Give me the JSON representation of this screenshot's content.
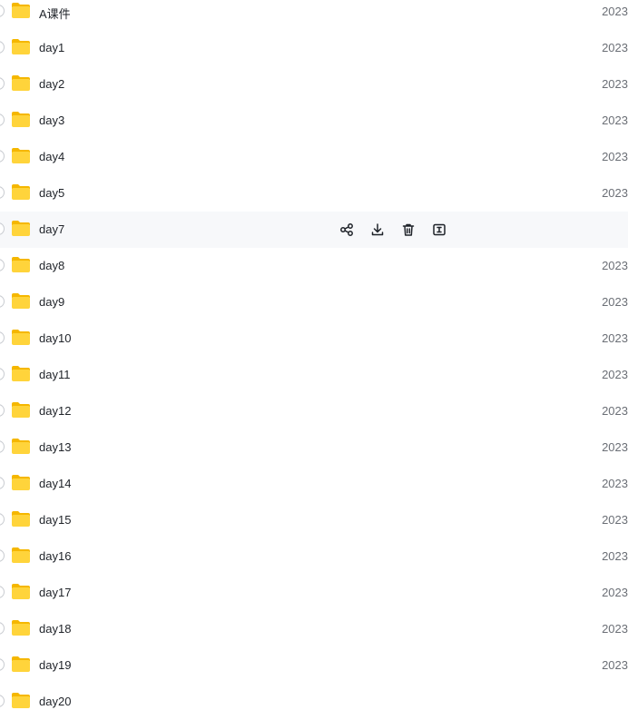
{
  "files": [
    {
      "name": "A课件",
      "date": "2023"
    },
    {
      "name": "day1",
      "date": "2023"
    },
    {
      "name": "day2",
      "date": "2023"
    },
    {
      "name": "day3",
      "date": "2023"
    },
    {
      "name": "day4",
      "date": "2023"
    },
    {
      "name": "day5",
      "date": "2023"
    },
    {
      "name": "day7",
      "date": ""
    },
    {
      "name": "day8",
      "date": "2023"
    },
    {
      "name": "day9",
      "date": "2023"
    },
    {
      "name": "day10",
      "date": "2023"
    },
    {
      "name": "day11",
      "date": "2023"
    },
    {
      "name": "day12",
      "date": "2023"
    },
    {
      "name": "day13",
      "date": "2023"
    },
    {
      "name": "day14",
      "date": "2023"
    },
    {
      "name": "day15",
      "date": "2023"
    },
    {
      "name": "day16",
      "date": "2023"
    },
    {
      "name": "day17",
      "date": "2023"
    },
    {
      "name": "day18",
      "date": "2023"
    },
    {
      "name": "day19",
      "date": "2023"
    },
    {
      "name": "day20",
      "date": ""
    }
  ],
  "hovered_row_index": 6,
  "hover_actions": [
    "share-icon",
    "download-icon",
    "trash-icon",
    "rename-icon"
  ],
  "colors": {
    "folder_body": "#ffd43b",
    "folder_tab": "#f5b700",
    "hover_bg": "#f7f8fa",
    "text": "#1f2329",
    "date_text": "#6b6f76"
  }
}
